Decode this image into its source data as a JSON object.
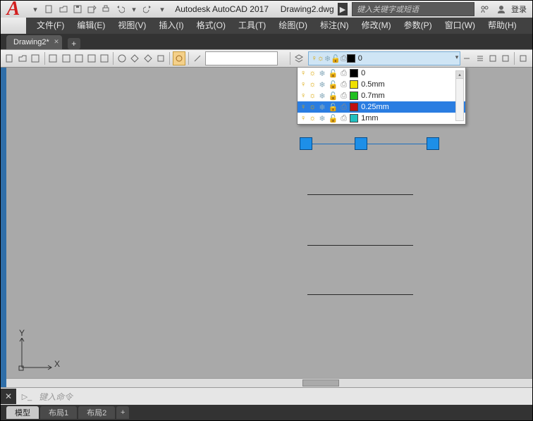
{
  "title": {
    "app": "Autodesk AutoCAD 2017",
    "doc": "Drawing2.dwg"
  },
  "search": {
    "placeholder": "键入关键字或短语"
  },
  "login_label": "登录",
  "menus": [
    {
      "label": "文件(F)"
    },
    {
      "label": "编辑(E)"
    },
    {
      "label": "视图(V)"
    },
    {
      "label": "插入(I)"
    },
    {
      "label": "格式(O)"
    },
    {
      "label": "工具(T)"
    },
    {
      "label": "绘图(D)"
    },
    {
      "label": "标注(N)"
    },
    {
      "label": "修改(M)"
    },
    {
      "label": "参数(P)"
    },
    {
      "label": "窗口(W)"
    },
    {
      "label": "帮助(H)"
    }
  ],
  "file_tab": {
    "label": "Drawing2*"
  },
  "layer_selected": {
    "name": "0",
    "color": "#000000"
  },
  "layer_options": [
    {
      "name": "0",
      "color": "#000000",
      "selected": false
    },
    {
      "name": "0.5mm",
      "color": "#f0e000",
      "selected": false
    },
    {
      "name": "0.7mm",
      "color": "#20c020",
      "selected": false
    },
    {
      "name": "0.25mm",
      "color": "#c01010",
      "selected": true
    },
    {
      "name": "1mm",
      "color": "#20c0c0",
      "selected": false
    }
  ],
  "tooltip": "0.25mm",
  "ucs": {
    "x": "X",
    "y": "Y"
  },
  "command_placeholder": "键入命令",
  "bottom_tabs": [
    {
      "label": "模型",
      "active": true
    },
    {
      "label": "布局1",
      "active": false
    },
    {
      "label": "布局2",
      "active": false
    }
  ]
}
